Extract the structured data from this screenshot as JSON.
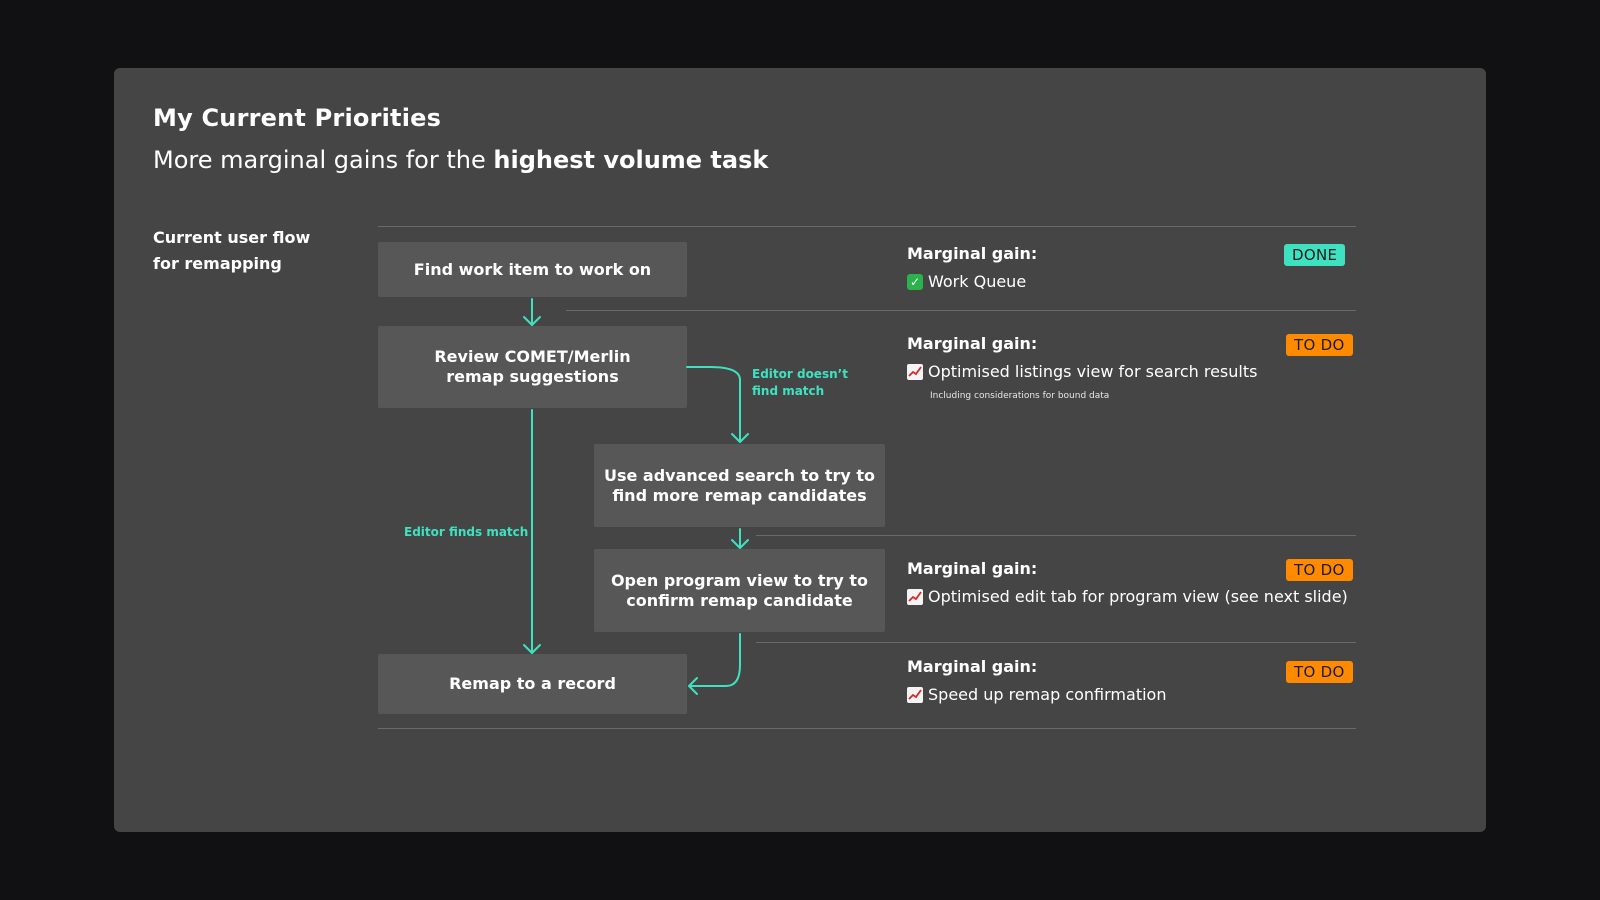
{
  "slide": {
    "title": "My Current Priorities",
    "subtitle_plain": "More marginal gains for the ",
    "subtitle_bold": "highest volume task",
    "flow_label_line1": "Current user flow",
    "flow_label_line2": "for remapping"
  },
  "flow": {
    "steps": [
      {
        "line1": "Find work item to work on",
        "line2": ""
      },
      {
        "line1": "Review COMET/Merlin",
        "line2": "remap suggestions"
      },
      {
        "line1": "Use advanced search to try to",
        "line2": "find more remap candidates"
      },
      {
        "line1": "Open program view to try to",
        "line2": "confirm remap candidate"
      },
      {
        "line1": "Remap to a record",
        "line2": ""
      }
    ],
    "edge_no_match_line1": "Editor doesn’t",
    "edge_no_match_line2": "find match",
    "edge_match": "Editor finds match"
  },
  "gains": [
    {
      "heading": "Marginal gain:",
      "icon": "check-icon",
      "item": "Work Queue",
      "note": "",
      "status": "DONE"
    },
    {
      "heading": "Marginal gain:",
      "icon": "chart-icon",
      "item": "Optimised listings view for search results",
      "note": "Including considerations for bound data",
      "status": "TO DO"
    },
    {
      "heading": "Marginal gain:",
      "icon": "chart-icon",
      "item": "Optimised edit tab for program view (see next slide)",
      "note": "",
      "status": "TO DO"
    },
    {
      "heading": "Marginal gain:",
      "icon": "chart-icon",
      "item": "Speed up remap confirmation",
      "note": "",
      "status": "TO DO"
    }
  ],
  "colors": {
    "slide_bg": "#454545",
    "page_bg": "#111012",
    "box_bg": "#575757",
    "accent_teal": "#3fe2c0",
    "todo_orange": "#ff8a00"
  }
}
